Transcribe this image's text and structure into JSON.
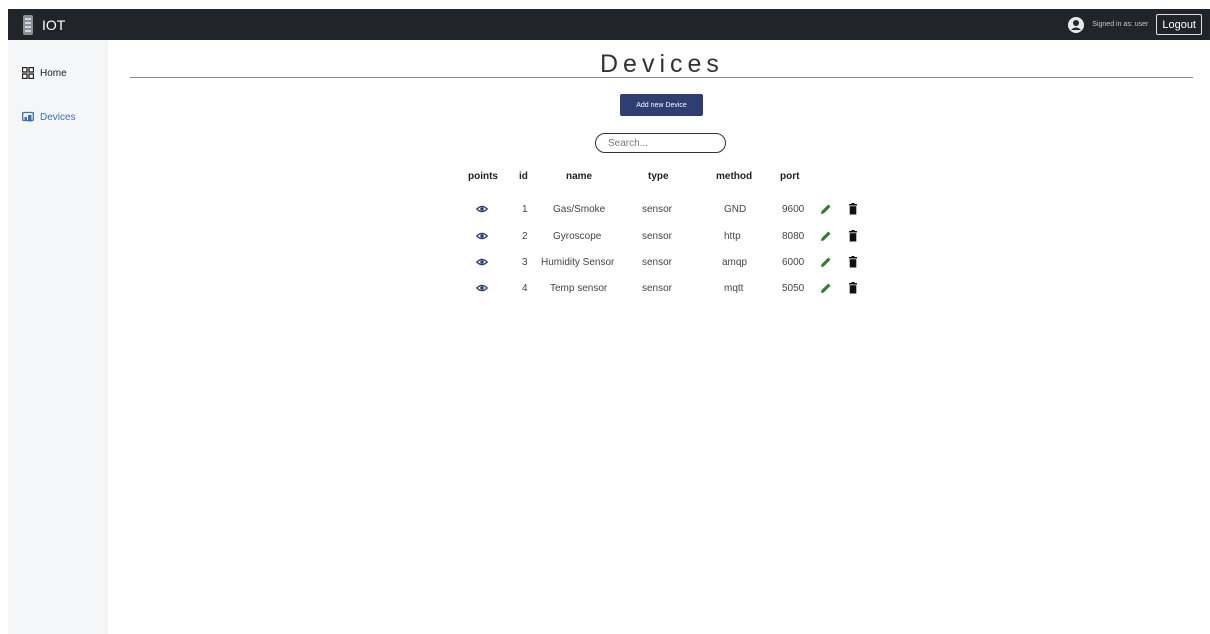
{
  "app": {
    "brand": "IOT"
  },
  "header": {
    "signed_in_text": "Signed in as: user",
    "logout_label": "Logout"
  },
  "sidebar": {
    "items": [
      {
        "label": "Home",
        "icon": "grid-icon"
      },
      {
        "label": "Devices",
        "icon": "devices-icon"
      }
    ]
  },
  "page": {
    "title": "Devices",
    "add_button_label": "Add new Device",
    "search_placeholder": "Search..."
  },
  "table": {
    "columns": [
      "points",
      "id",
      "name",
      "type",
      "method",
      "port"
    ],
    "rows": [
      {
        "id": "1",
        "name": "Gas/Smoke",
        "type": "sensor",
        "method": "GND",
        "port": "9600"
      },
      {
        "id": "2",
        "name": "Gyroscope",
        "type": "sensor",
        "method": "http",
        "port": "8080"
      },
      {
        "id": "3",
        "name": "Humidity Sensor",
        "type": "sensor",
        "method": "amqp",
        "port": "6000"
      },
      {
        "id": "4",
        "name": "Temp sensor",
        "type": "sensor",
        "method": "mqtt",
        "port": "5050"
      }
    ]
  },
  "colors": {
    "topbar": "#212529",
    "accent": "#2c3e72",
    "active_link": "#3b6fb6",
    "edit_icon": "#2e7d32"
  }
}
